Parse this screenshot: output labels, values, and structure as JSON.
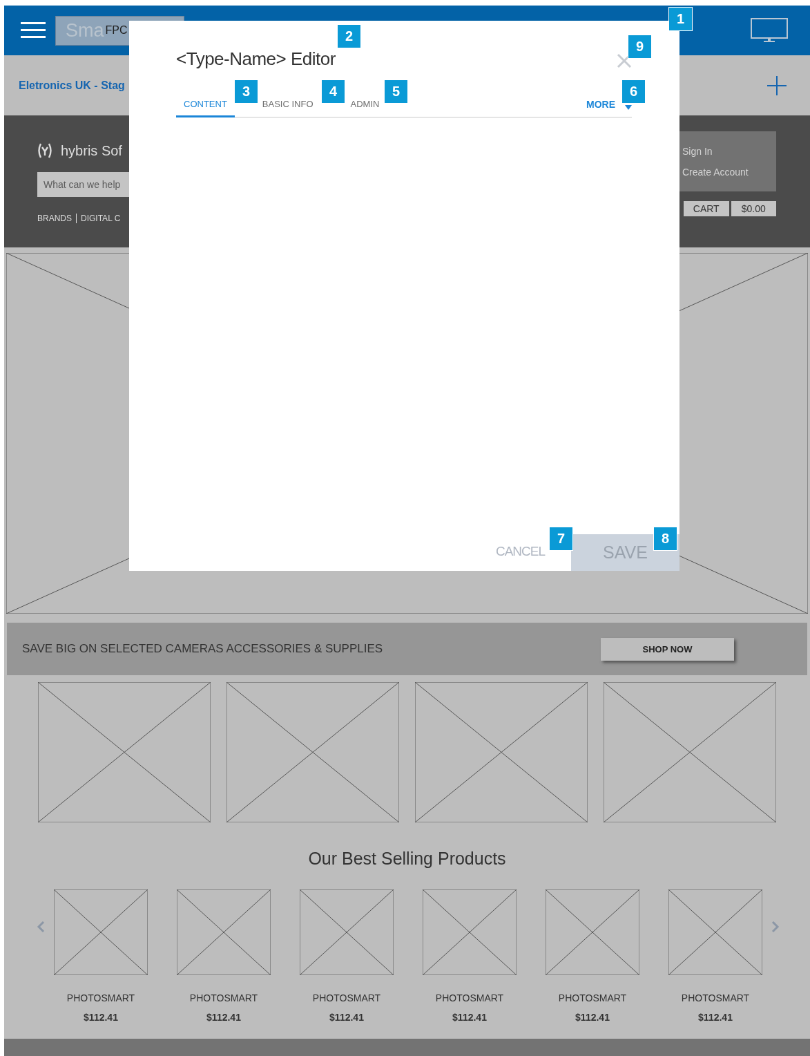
{
  "top_bar": {
    "logo": "Sma",
    "logo_overlay": "FPC"
  },
  "site_bar": {
    "site": "Eletronics UK - Stag"
  },
  "header": {
    "brand": "hybris Sof",
    "search": {
      "placeholder": "What can we help"
    },
    "nav": [
      "BRANDS",
      "DIGITAL C"
    ],
    "account": [
      "Sign In",
      "Create Account"
    ],
    "cart": {
      "label": "CART",
      "total": "$0.00"
    }
  },
  "banner": {
    "text": "SAVE BIG ON SELECTED CAMERAS ACCESSORIES & SUPPLIES",
    "button": "SHOP NOW"
  },
  "best_sellers": {
    "title": "Our Best Selling Products",
    "products": [
      {
        "name": "PHOTOSMART",
        "price": "$112.41"
      },
      {
        "name": "PHOTOSMART",
        "price": "$112.41"
      },
      {
        "name": "PHOTOSMART",
        "price": "$112.41"
      },
      {
        "name": "PHOTOSMART",
        "price": "$112.41"
      },
      {
        "name": "PHOTOSMART",
        "price": "$112.41"
      },
      {
        "name": "PHOTOSMART",
        "price": "$112.41"
      }
    ]
  },
  "editor": {
    "title": "<Type-Name> Editor",
    "tabs": [
      {
        "label": "CONTENT",
        "selected": true
      },
      {
        "label": "BASIC INFO",
        "selected": false
      },
      {
        "label": "ADMIN",
        "selected": false
      }
    ],
    "more": "MORE",
    "cancel": "CANCEL",
    "save": "SAVE"
  },
  "callouts": [
    "1",
    "2",
    "3",
    "4",
    "5",
    "6",
    "7",
    "8",
    "9"
  ]
}
